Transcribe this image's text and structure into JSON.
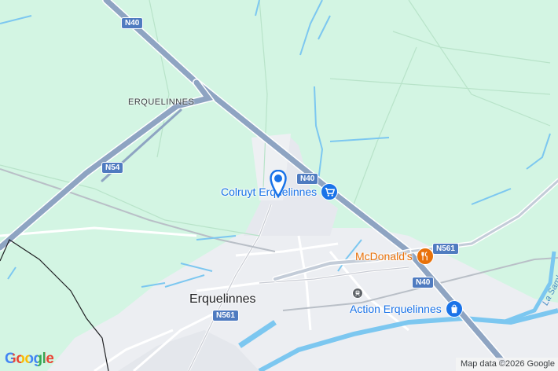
{
  "map": {
    "roads": {
      "n40_north": "N40",
      "n54": "N54",
      "n40_center": "N40",
      "n561_east": "N561",
      "n40_south": "N40",
      "n561_town": "N561"
    },
    "places": {
      "town": "Erquelinnes",
      "locality": "ERQUELINNES"
    },
    "pois": [
      {
        "label": "Colruyt Erquelinnes",
        "icon": "shopping-cart-icon",
        "color": "#1a73e8"
      },
      {
        "label": "McDonald's",
        "icon": "fork-knife-icon",
        "color": "#e8710a"
      },
      {
        "label": "Action Erquelinnes",
        "icon": "shopping-bag-icon",
        "color": "#1a73e8"
      }
    ],
    "river": "La Sambre",
    "pin": {
      "icon": "location-pin-icon",
      "color": "#1a73e8"
    },
    "station": {
      "icon": "train-station-icon"
    }
  },
  "footer": {
    "logo": "Google",
    "attribution": "Map data ©2026 Google"
  },
  "colors": {
    "land": "#d3f5e3",
    "urban": "#eceef2",
    "highway": "#8ea4c2",
    "water": "#7cc7f0",
    "pin": "#1a73e8"
  }
}
